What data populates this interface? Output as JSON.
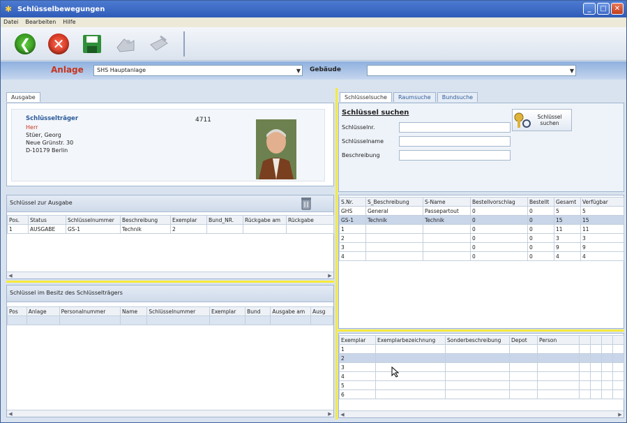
{
  "window": {
    "title": "Schlüsselbewegungen"
  },
  "menu": [
    "Datei",
    "Bearbeiten",
    "Hilfe"
  ],
  "toolbar": {
    "icons": [
      "back-icon",
      "cancel-icon",
      "save-icon",
      "key-hand-icon",
      "print-icon"
    ]
  },
  "anlage": {
    "label": "Anlage",
    "value": "SHS Hauptanlage",
    "gebaeude_label": "Gebäude",
    "gebaeude_value": ""
  },
  "left_tab": "Ausgabe",
  "traeger": {
    "heading": "Schlüsselträger",
    "salutation": "Herr",
    "name": "Stüer, Georg",
    "street": "Neue Grünstr. 30",
    "city": "D-10179 Berlin",
    "number": "4711"
  },
  "ausgabe": {
    "title": "Schlüssel zur Ausgabe",
    "columns": [
      "Pos.",
      "Status",
      "Schlüsselnummer",
      "Beschreibung",
      "Exemplar",
      "Bund_NR.",
      "Rückgabe am",
      "Rückgabe"
    ],
    "rows": [
      [
        "1",
        "AUSGABE",
        "GS-1",
        "Technik",
        "2",
        "",
        "",
        ""
      ]
    ]
  },
  "besitz": {
    "title": "Schlüssel im Besitz des Schlüsselträgers",
    "columns": [
      "Pos",
      "Anlage",
      "Personalnummer",
      "Name",
      "Schlüsselnummer",
      "Exemplar",
      "Bund",
      "Ausgabe am",
      "Ausg"
    ]
  },
  "right_tabs": [
    "Schlüsselsuche",
    "Raumsuche",
    "Bundsuche"
  ],
  "suche": {
    "heading": "Schlüssel suchen",
    "fields": [
      "Schlüsselnr.",
      "Schlüsselname",
      "Beschreibung"
    ],
    "button": "Schlüssel suchen"
  },
  "results": {
    "columns": [
      "S.Nr.",
      "S_Beschreibung",
      "S-Name",
      "Bestellvorschlag",
      "Bestellt",
      "Gesamt",
      "Verfügbar"
    ],
    "rows": [
      [
        "GHS",
        "General",
        "Passepartout",
        "0",
        "0",
        "5",
        "5"
      ],
      [
        "GS-1",
        "Technik",
        "Technik",
        "0",
        "0",
        "15",
        "15"
      ],
      [
        "1",
        "",
        "",
        "0",
        "0",
        "11",
        "11"
      ],
      [
        "2",
        "",
        "",
        "0",
        "0",
        "3",
        "3"
      ],
      [
        "3",
        "",
        "",
        "0",
        "0",
        "9",
        "9"
      ],
      [
        "4",
        "",
        "",
        "0",
        "0",
        "4",
        "4"
      ]
    ]
  },
  "exemplar": {
    "columns": [
      "Exemplar",
      "Exemplarbezeichnung",
      "Sonderbeschreibung",
      "Depot",
      "Person",
      "",
      "",
      "",
      ""
    ],
    "rows": [
      "1",
      "2",
      "3",
      "4",
      "5",
      "6"
    ]
  },
  "colors": {
    "accent": "#c7341e",
    "title": "#2f5cb8",
    "separator": "#f7ea3a"
  }
}
